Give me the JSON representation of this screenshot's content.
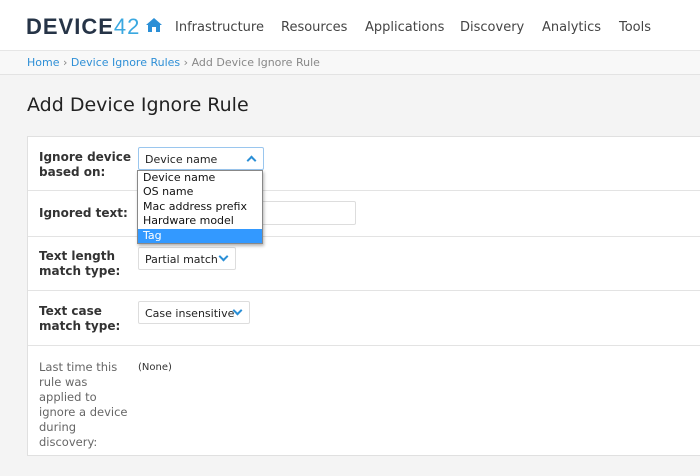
{
  "header": {
    "logo_main": "DEVICE",
    "logo_accent": "42",
    "nav": [
      "Infrastructure",
      "Resources",
      "Applications",
      "Discovery",
      "Analytics",
      "Tools"
    ]
  },
  "breadcrumb": {
    "home": "Home",
    "parent": "Device Ignore Rules",
    "current": "Add Device Ignore Rule",
    "sep": "›"
  },
  "page_title": "Add Device Ignore Rule",
  "form": {
    "ignore_based_on": {
      "label": "Ignore device based on:",
      "value": "Device name",
      "options": [
        "Device name",
        "OS name",
        "Mac address prefix",
        "Hardware model",
        "Tag"
      ],
      "highlighted": "Tag"
    },
    "ignored_text": {
      "label": "Ignored text:",
      "value": ""
    },
    "length_match": {
      "label": "Text length match type:",
      "value": "Partial match"
    },
    "case_match": {
      "label": "Text case match type:",
      "value": "Case insensitive"
    },
    "last_applied": {
      "label": "Last time this rule was applied to ignore a device during discovery:",
      "value": "(None)"
    }
  },
  "colors": {
    "accent": "#2e8fd6",
    "highlight": "#3399ff"
  }
}
